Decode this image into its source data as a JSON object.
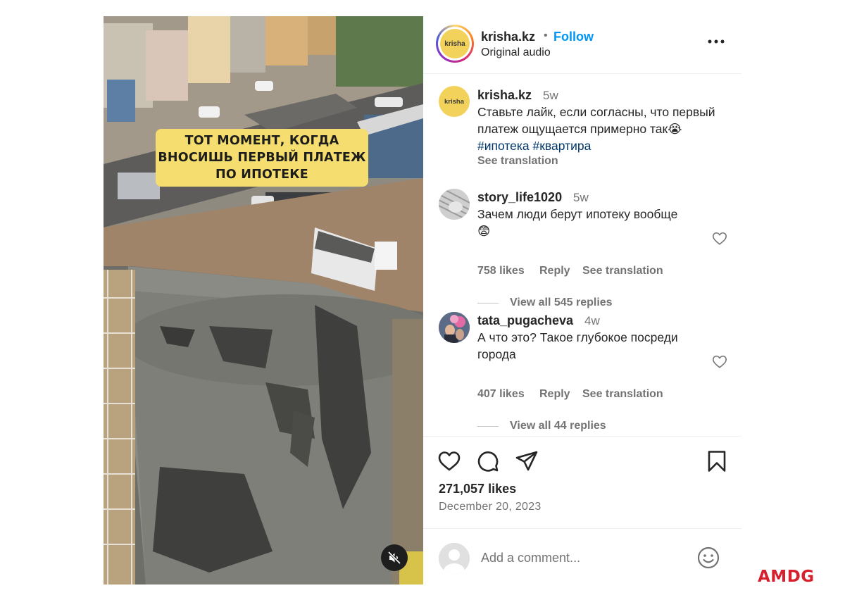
{
  "media": {
    "caption_lines": [
      "ТОТ МОМЕНТ, КОГДА",
      "ВНОСИШЬ ПЕРВЫЙ ПЛАТЕЖ",
      "ПО ИПОТЕКЕ"
    ],
    "mute_icon": "speaker-muted-icon"
  },
  "header": {
    "avatar_text": "krisha",
    "username": "krisha.kz",
    "separator": "•",
    "follow_label": "Follow",
    "audio": "Original audio",
    "more_icon": "more-horizontal-icon"
  },
  "caption": {
    "avatar_text": "krisha",
    "username": "krisha.kz",
    "time": "5w",
    "text": "Ставьте лайк, если согласны, что первый платеж ощущается примерно так😭",
    "hashtags": [
      "#ипотека",
      "#квартира"
    ],
    "see_translation": "See translation"
  },
  "comments": [
    {
      "username": "story_life1020",
      "time": "5w",
      "text_line1": "Зачем люди берут ипотеку вообще",
      "text_line2": "😨",
      "likes": "758 likes",
      "reply": "Reply",
      "see_translation": "See translation",
      "view_replies": "View all 545 replies"
    },
    {
      "username": "tata_pugacheva",
      "time": "4w",
      "text_line1": "А что это? Такое глубокое посреди",
      "text_line2": "города",
      "likes": "407 likes",
      "reply": "Reply",
      "see_translation": "See translation",
      "view_replies": "View all 44 replies"
    }
  ],
  "actions": {
    "like_icon": "heart-icon",
    "comment_icon": "comment-icon",
    "share_icon": "share-icon",
    "save_icon": "bookmark-icon",
    "likes": "271,057 likes",
    "date": "December 20, 2023"
  },
  "add_comment": {
    "placeholder": "Add a comment...",
    "emoji_icon": "emoji-icon"
  },
  "watermark": "AMDG",
  "colors": {
    "follow": "#0095f6",
    "hashtag": "#00376b",
    "caption_bg": "#f6dd6f",
    "brand_red": "#d6202e"
  }
}
